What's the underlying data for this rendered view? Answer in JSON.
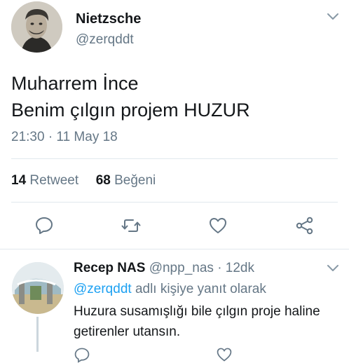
{
  "tweet": {
    "display_name": "Nietzsche",
    "handle": "@zerqddt",
    "text_line1": "Muharrem İnce",
    "text_line2": "Benim çılgın projem HUZUR",
    "timestamp": "21:30 · 11 May 18",
    "retweet_count": "14",
    "retweet_label": "Retweet",
    "like_count": "68",
    "like_label": "Beğeni"
  },
  "reply": {
    "display_name": "Recep NAS",
    "handle": "@npp_nas",
    "separator": "·",
    "time": "12dk",
    "mention": "@zerqddt",
    "reply_label": "adlı kişiye yanıt olarak",
    "text": "Huzura susamışlığı bile çılgın proje haline getirenler utansın."
  },
  "icons": [
    "chevron-down-icon",
    "reply-icon",
    "retweet-icon",
    "like-icon",
    "share-icon"
  ],
  "colors": {
    "link": "#1da1f2",
    "secondary_text": "#657786",
    "primary_text": "#14171a",
    "divider": "#e1e8ed"
  }
}
